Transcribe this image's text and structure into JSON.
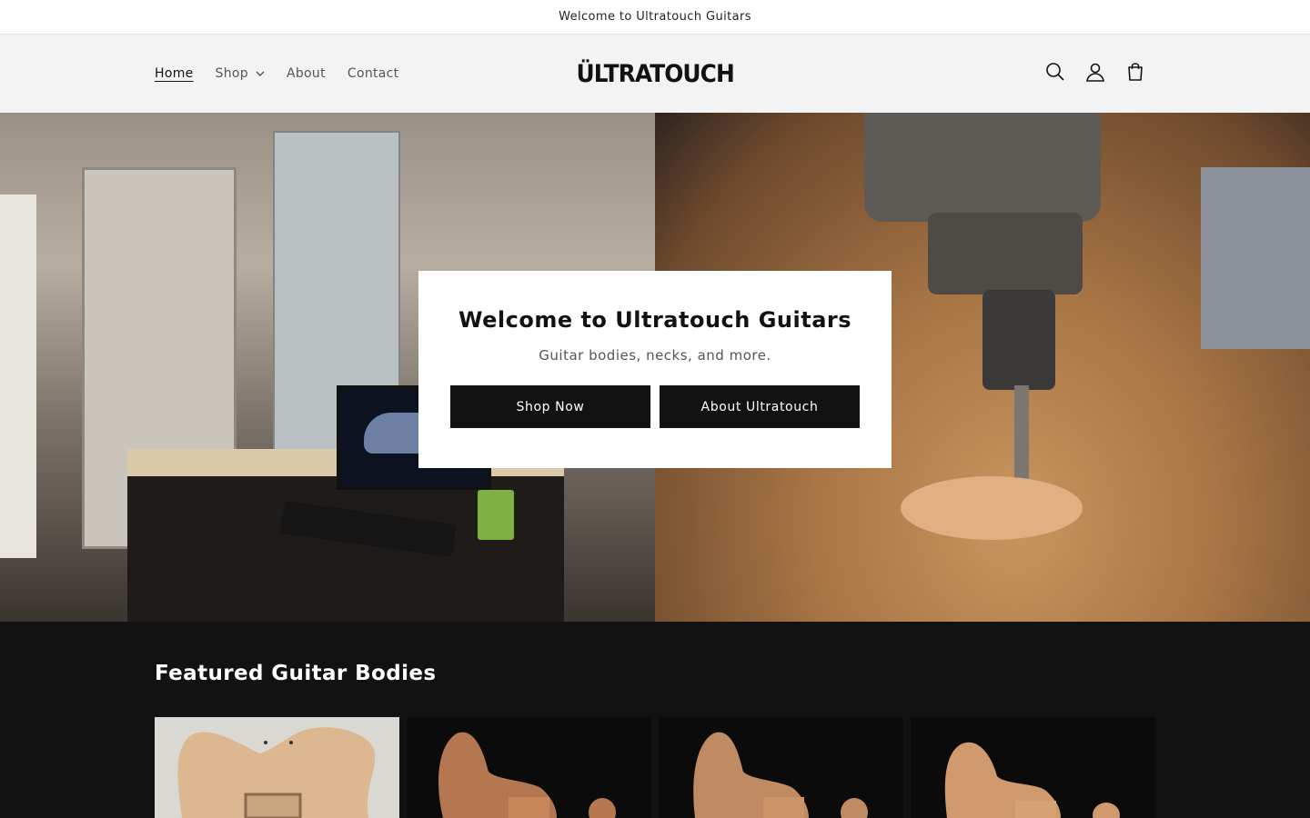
{
  "announcement": {
    "text": "Welcome to Ultratouch Guitars"
  },
  "header": {
    "nav": [
      {
        "label": "Home",
        "active": true
      },
      {
        "label": "Shop",
        "has_dropdown": true
      },
      {
        "label": "About"
      },
      {
        "label": "Contact"
      }
    ],
    "logo_text": "ÜLTRATOUCH",
    "icons": [
      "search-icon",
      "account-icon",
      "cart-icon"
    ]
  },
  "hero": {
    "title": "Welcome to Ultratouch Guitars",
    "subtitle": "Guitar bodies, necks, and more.",
    "buttons": [
      {
        "label": "Shop Now"
      },
      {
        "label": "About Ultratouch"
      }
    ]
  },
  "featured": {
    "title": "Featured Guitar Bodies",
    "products": [
      {
        "image": "guitar-body-image"
      },
      {
        "image": "guitar-body-image"
      },
      {
        "image": "guitar-body-image"
      },
      {
        "image": "guitar-body-image"
      }
    ]
  },
  "colors": {
    "primary": "#121212",
    "header_bg": "#f3f3f3",
    "card_bg": "#ffffff"
  }
}
